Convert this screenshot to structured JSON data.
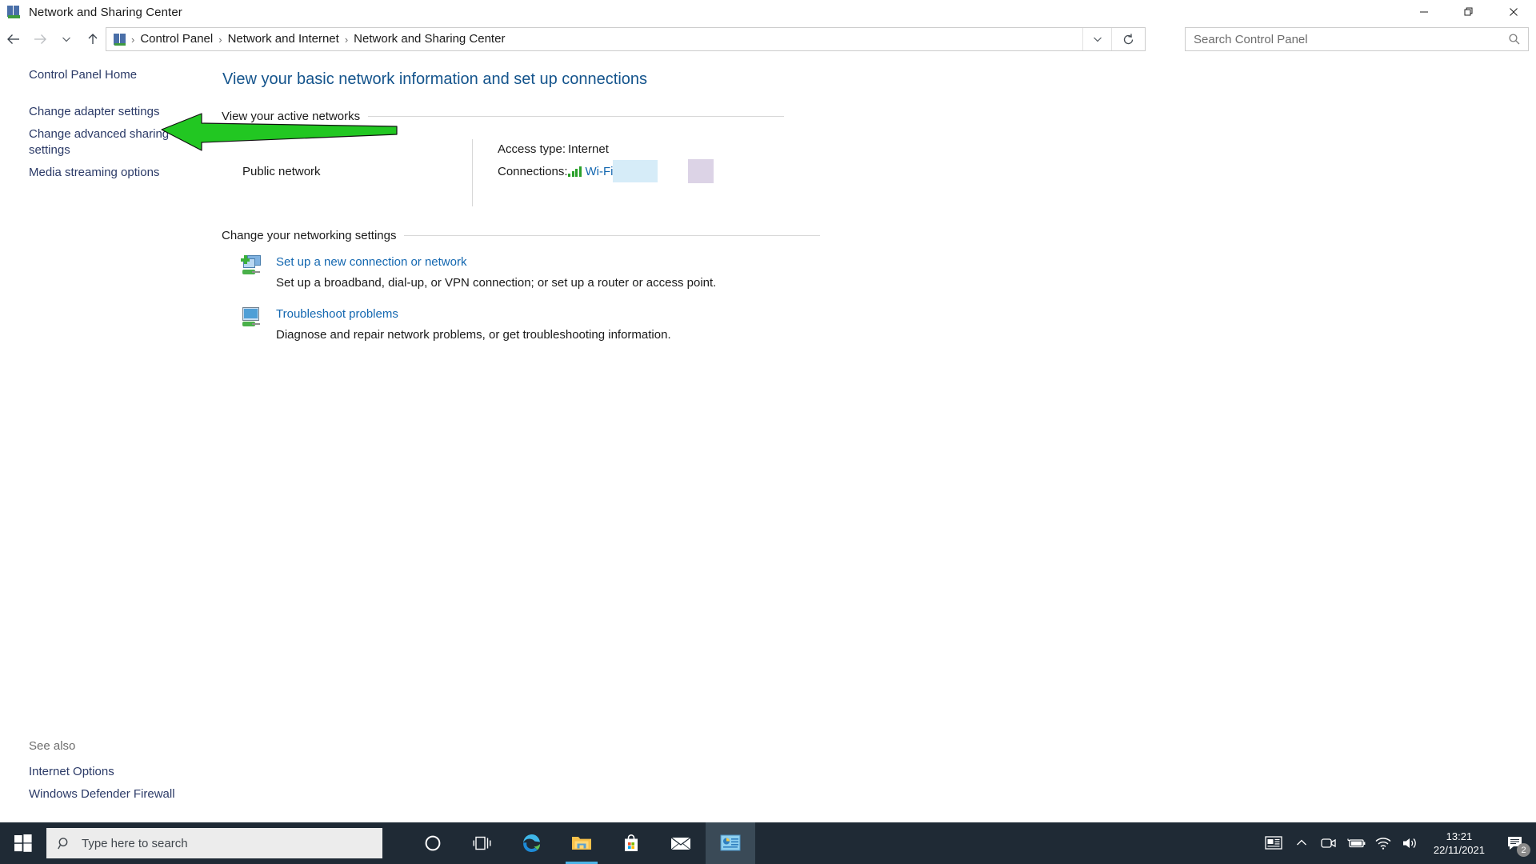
{
  "window": {
    "title": "Network and Sharing Center",
    "icon": "network-sharing-icon",
    "minimize_label": "—",
    "restore_label": "❐",
    "close_label": "✕"
  },
  "navbar": {
    "back_label": "Back",
    "forward_label": "Forward",
    "recent_label": "Recent locations",
    "up_label": "Up",
    "breadcrumbs": [
      "Control Panel",
      "Network and Internet",
      "Network and Sharing Center"
    ],
    "separator": "›",
    "dropdown_label": "Previous locations",
    "refresh_label": "Refresh"
  },
  "search": {
    "placeholder": "Search Control Panel",
    "value": ""
  },
  "sidebar": {
    "items": [
      {
        "label": "Control Panel Home",
        "name": "sidebar-item-control-panel-home"
      },
      {
        "label": "Change adapter settings",
        "name": "sidebar-item-change-adapter-settings"
      },
      {
        "label": "Change advanced sharing settings",
        "name": "sidebar-item-change-advanced-sharing-settings"
      },
      {
        "label": "Media streaming options",
        "name": "sidebar-item-media-streaming-options"
      }
    ],
    "see_also_title": "See also",
    "see_also_items": [
      {
        "label": "Internet Options",
        "name": "see-also-internet-options"
      },
      {
        "label": "Windows Defender Firewall",
        "name": "see-also-windows-defender-firewall"
      }
    ]
  },
  "main": {
    "page_title": "View your basic network information and set up connections",
    "active_networks_header": "View your active networks",
    "network": {
      "name_line": "Public network",
      "access_type_label": "Access type:",
      "access_type_value": "Internet",
      "connections_label": "Connections:",
      "connection_link": "Wi-Fi"
    },
    "change_settings_header": "Change your networking settings",
    "tasks": [
      {
        "link": "Set up a new connection or network",
        "desc": "Set up a broadband, dial-up, or VPN connection; or set up a router or access point.",
        "icon": "new-connection-icon"
      },
      {
        "link": "Troubleshoot problems",
        "desc": "Diagnose and repair network problems, or get troubleshooting information.",
        "icon": "troubleshoot-icon"
      }
    ]
  },
  "annotation": {
    "arrow_color": "#22c722",
    "arrow_target": "Change adapter settings"
  },
  "taskbar": {
    "start_label": "Start",
    "search_placeholder": "Type here to search",
    "apps": [
      {
        "name": "taskbar-cortana",
        "label": "Cortana"
      },
      {
        "name": "taskbar-task-view",
        "label": "Task View"
      },
      {
        "name": "taskbar-microsoft-edge",
        "label": "Microsoft Edge"
      },
      {
        "name": "taskbar-file-explorer",
        "label": "File Explorer"
      },
      {
        "name": "taskbar-microsoft-store",
        "label": "Microsoft Store"
      },
      {
        "name": "taskbar-mail",
        "label": "Mail"
      },
      {
        "name": "taskbar-control-panel",
        "label": "Control Panel"
      }
    ],
    "tray": {
      "news_label": "News and interests",
      "overflow_label": "Show hidden icons",
      "meet_label": "Meet Now",
      "battery_label": "Battery",
      "network_label": "Network",
      "volume_label": "Volume",
      "time": "13:21",
      "date": "22/11/2021",
      "notification_count": "2"
    }
  },
  "colors": {
    "accent_link": "#1367b0",
    "title_blue": "#14548c",
    "taskbar_bg": "#1f2a35",
    "arrow_green": "#22c722",
    "redact_blue": "#d6ecf8",
    "redact_purple": "#dcd3e6"
  }
}
